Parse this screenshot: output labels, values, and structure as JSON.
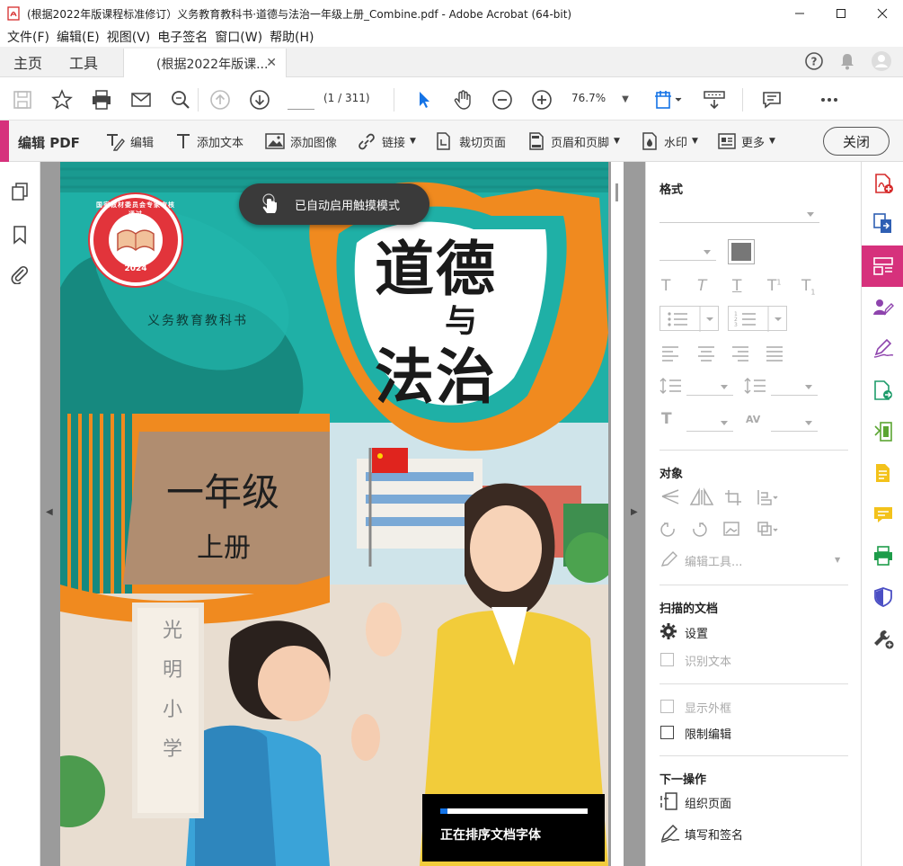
{
  "window": {
    "title": "(根据2022年版课程标准修订）义务教育教科书·道德与法治一年级上册_Combine.pdf - Adobe Acrobat (64-bit)"
  },
  "menu": [
    "文件(F)",
    "编辑(E)",
    "视图(V)",
    "电子签名",
    "窗口(W)",
    "帮助(H)"
  ],
  "tabs": {
    "home": "主页",
    "tools": "工具",
    "document": "(根据2022年版课..."
  },
  "toolbar": {
    "page_current": "",
    "page_total": "(1 / 311)",
    "zoom": "76.7%"
  },
  "editbar": {
    "title": "编辑 PDF",
    "tools": [
      {
        "label": "编辑",
        "icon": "edit-text-icon",
        "dropdown": false
      },
      {
        "label": "添加文本",
        "icon": "add-text-icon",
        "dropdown": false
      },
      {
        "label": "添加图像",
        "icon": "add-image-icon",
        "dropdown": false
      },
      {
        "label": "链接",
        "icon": "link-icon",
        "dropdown": true
      },
      {
        "label": "裁切页面",
        "icon": "crop-icon",
        "dropdown": false
      },
      {
        "label": "页眉和页脚",
        "icon": "header-footer-icon",
        "dropdown": true
      },
      {
        "label": "水印",
        "icon": "watermark-icon",
        "dropdown": true
      },
      {
        "label": "更多",
        "icon": "more-icon",
        "dropdown": true
      }
    ],
    "close": "关闭"
  },
  "toast": {
    "text": "已自动启用触摸模式"
  },
  "loading": {
    "text": "正在排序文档字体",
    "progress": 0.05
  },
  "cover": {
    "seal_top": "国家教材委员会专家审核通过",
    "seal_year": "2024",
    "series": "义务教育教科书",
    "title_1": "道德",
    "title_2": "与",
    "title_3": "法治",
    "grade": "一年级",
    "volume": "上册",
    "school_sign": [
      "光",
      "明",
      "小",
      "学"
    ]
  },
  "format_panel": {
    "format_heading": "格式",
    "object_heading": "对象",
    "edit_tools": "编辑工具...",
    "scanned_heading": "扫描的文档",
    "settings": "设置",
    "recognize": "识别文本",
    "show_bbox": "显示外框",
    "restrict": "限制编辑",
    "next_heading": "下一操作",
    "organize": "组织页面",
    "fill_sign": "填写和签名"
  },
  "colors": {
    "accent": "#d6317c",
    "cover_teal": "#1fb0a6",
    "cover_orange": "#f08a1f",
    "seal_red": "#e2343b",
    "grade_panel": "#b08d70"
  }
}
